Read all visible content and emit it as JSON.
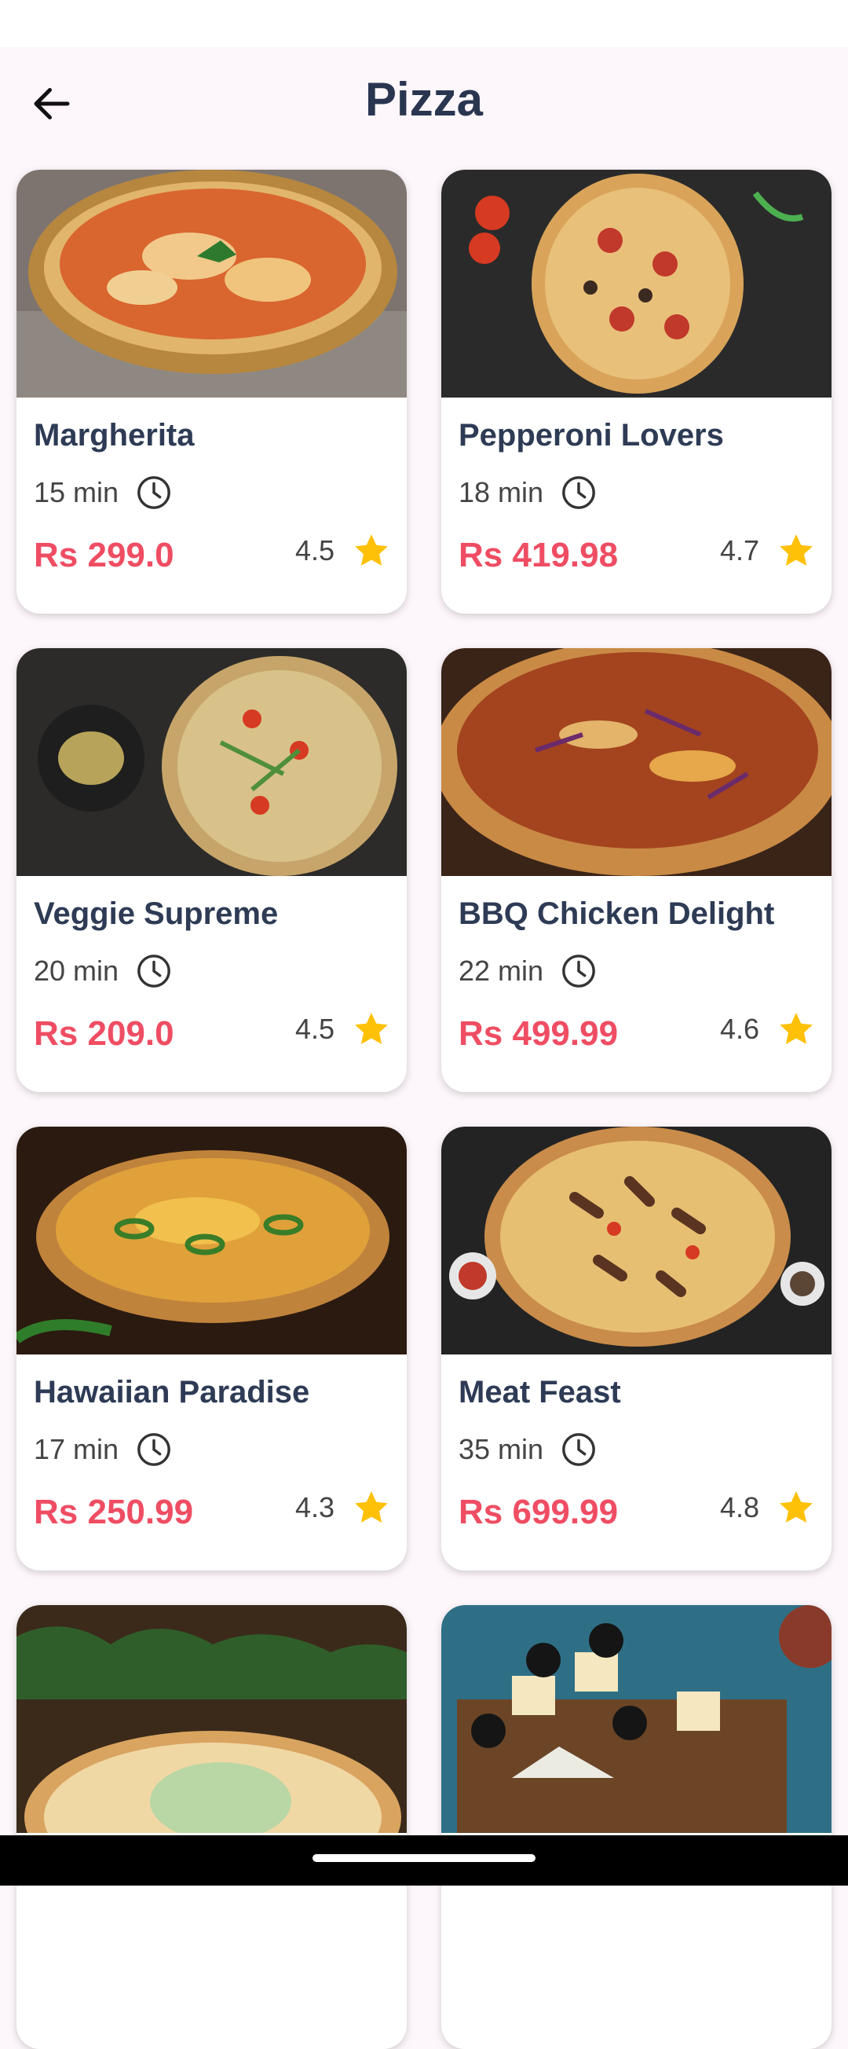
{
  "header": {
    "title": "Pizza",
    "back_icon": "arrow-left-icon"
  },
  "colors": {
    "accent": "#ef4d63",
    "title": "#2a3650",
    "star": "#ffc107",
    "background": "#fdf7fb"
  },
  "items": [
    {
      "name": "Margherita",
      "time": "15 min",
      "price": "Rs 299.0",
      "rating": "4.5"
    },
    {
      "name": "Pepperoni Lovers",
      "time": "18 min",
      "price": "Rs 419.98",
      "rating": "4.7"
    },
    {
      "name": "Veggie Supreme",
      "time": "20 min",
      "price": "Rs 209.0",
      "rating": "4.5"
    },
    {
      "name": "BBQ Chicken Delight",
      "time": "22 min",
      "price": "Rs 499.99",
      "rating": "4.6"
    },
    {
      "name": "Hawaiian Paradise",
      "time": "17 min",
      "price": "Rs 250.99",
      "rating": "4.3"
    },
    {
      "name": "Meat Feast",
      "time": "35 min",
      "price": "Rs 699.99",
      "rating": "4.8"
    }
  ]
}
